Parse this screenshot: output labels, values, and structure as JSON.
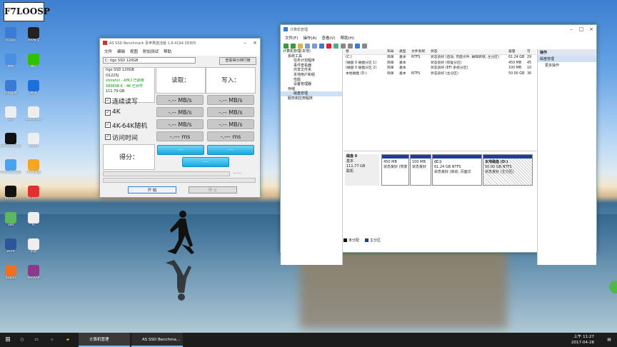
{
  "desktop": {
    "logo_text": "F7LOOSP",
    "icons": [
      {
        "label": "此电脑",
        "color": "#3a7bd5"
      },
      {
        "label": "360安全",
        "color": "#222"
      },
      {
        "label": "网络",
        "color": "#4a90e2"
      },
      {
        "label": "微信",
        "color": "#2dc100"
      },
      {
        "label": "控制面板",
        "color": "#3a7bd5"
      },
      {
        "label": "腾讯",
        "color": "#1e6fd9"
      },
      {
        "label": "ZS",
        "color": "#eee"
      },
      {
        "label": "asssd.exe",
        "color": "#eee"
      },
      {
        "label": "GeForce Experience",
        "color": "#111"
      },
      {
        "label": "asssd",
        "color": "#eee"
      },
      {
        "label": "360安全浏览器",
        "color": "#4aa3f0"
      },
      {
        "label": "UC浏览器",
        "color": "#f5a623"
      },
      {
        "label": "腾讯QQ",
        "color": "#111"
      },
      {
        "label": "TV",
        "color": "#e03030"
      },
      {
        "label": "360",
        "color": "#5cb85c"
      },
      {
        "label": "IE",
        "color": "#eee"
      },
      {
        "label": "word",
        "color": "#2b579a"
      },
      {
        "label": "新建",
        "color": "#eee"
      },
      {
        "label": "Kugou",
        "color": "#f07020"
      },
      {
        "label": "WinRAR",
        "color": "#8b3a8b"
      }
    ]
  },
  "asssd": {
    "title": "AS SSD Benchmark 青苹果激活版 1.8.4194.39305",
    "menu": [
      "文件",
      "编辑",
      "视图",
      "附加测试",
      "帮助"
    ],
    "drive_select": "C: tigo SSD 120GB",
    "rank_button": "查看得分排行榜",
    "info": [
      "tigo SSD 120GB",
      "O1225J",
      "storahci - AHCI 已启用",
      "580608 K - 4K 已对齐",
      "111.79 GB"
    ],
    "read_header": "读取：",
    "write_header": "写入：",
    "tests": [
      {
        "label": "连续读写",
        "read": "-.-- MB/s",
        "write": "-.-- MB/s"
      },
      {
        "label": "4K",
        "read": "-.-- MB/s",
        "write": "-.-- MB/s"
      },
      {
        "label": "4K-64K随机",
        "read": "-.-- MB/s",
        "write": "-.-- MB/s"
      },
      {
        "label": "访问时间",
        "read": "-.--- ms",
        "write": "-.--- ms"
      }
    ],
    "score_label": "得分：",
    "score_read": "----",
    "score_write": "----",
    "score_total": "-----",
    "progress_time": "-:--:--",
    "start_button": "开 始",
    "stop_button": "停 止"
  },
  "compmgmt": {
    "title": "计算机管理",
    "menu": [
      "文件(F)",
      "操作(A)",
      "查看(V)",
      "帮助(H)"
    ],
    "tree": [
      "计算机管理(本地)",
      "系统工具",
      "任务计划程序",
      "事件查看器",
      "共享文件夹",
      "本地用户和组",
      "性能",
      "设备管理器",
      "存储",
      "磁盘管理",
      "服务和应用程序"
    ],
    "columns": [
      "卷",
      "布局",
      "类型",
      "文件系统",
      "状态",
      "容量",
      "可"
    ],
    "volumes": [
      {
        "name": "(C:)",
        "layout": "简单",
        "type": "基本",
        "fs": "NTFS",
        "status": "状态良好 (启动, 页面文件, 故障转储, 主分区)",
        "capacity": "61.24 GB",
        "free": "29"
      },
      {
        "name": "(磁盘 0 磁盘分区 1)",
        "layout": "简单",
        "type": "基本",
        "fs": "",
        "status": "状态良好 (恢复分区)",
        "capacity": "450 MB",
        "free": "45"
      },
      {
        "name": "(磁盘 0 磁盘分区 2)",
        "layout": "简单",
        "type": "基本",
        "fs": "",
        "status": "状态良好 (EFI 系统分区)",
        "capacity": "100 MB",
        "free": "10"
      },
      {
        "name": "本地磁盘 (D:)",
        "layout": "简单",
        "type": "基本",
        "fs": "NTFS",
        "status": "状态良好 (主分区)",
        "capacity": "50.00 GB",
        "free": "36"
      }
    ],
    "disk": {
      "name": "磁盘 0",
      "type": "基本",
      "size": "111.77 GB",
      "status": "联机"
    },
    "partitions": [
      {
        "title": "",
        "size": "450 MB",
        "status": "状态良好 (恢复"
      },
      {
        "title": "",
        "size": "100 MB",
        "status": "状态良好"
      },
      {
        "title": "(C:)",
        "size": "61.24 GB NTFS",
        "status": "状态良好 (启动, 页面文"
      },
      {
        "title": "本地磁盘 (D:)",
        "size": "50.00 GB NTFS",
        "status": "状态良好 (主分区)"
      }
    ],
    "legend": [
      "未分配",
      "主分区"
    ],
    "actions_header": "操作",
    "actions_sub": "磁盘管理",
    "actions_more": "更多操作"
  },
  "taskbar": {
    "tasks": [
      "计算机管理",
      "AS SSD Benchma..."
    ],
    "time": "上午 11:27",
    "date": "2017-04-28"
  }
}
